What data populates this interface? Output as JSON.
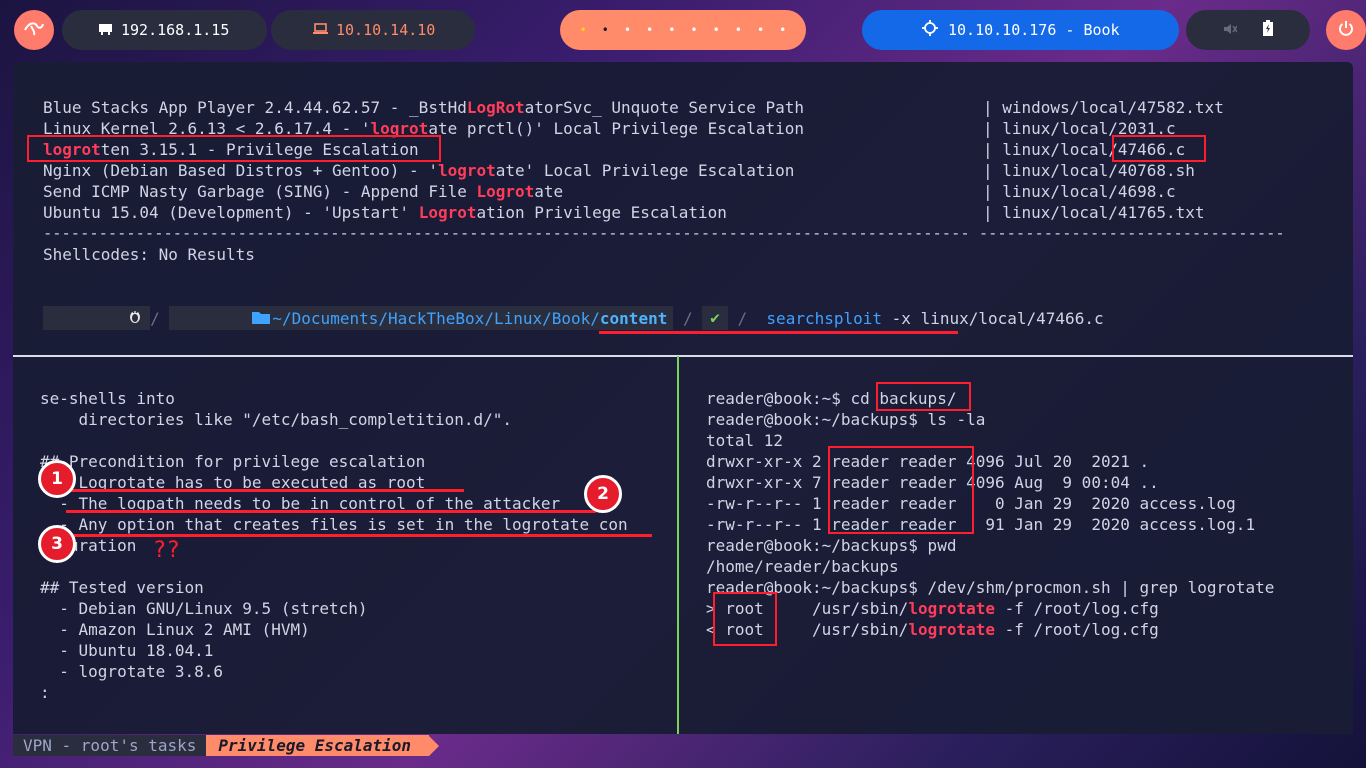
{
  "topbar": {
    "local_ip": "192.168.1.15",
    "vpn_ip": "10.10.14.10",
    "target": "10.10.10.176 - Book",
    "workspace_dots": [
      "•",
      "•",
      "•",
      "•",
      "•",
      "•",
      "•",
      "•",
      "•",
      "•"
    ]
  },
  "search_results": [
    {
      "title_pre": "Blue Stacks App Player 2.4.44.62.57 - _BstHd",
      "title_hl": "LogRot",
      "title_post": "atorSvc_ Unquote Service Path",
      "path": "windows/local/47582.txt"
    },
    {
      "title_pre": "Linux Kernel 2.6.13 < 2.6.17.4 - '",
      "title_hl": "logrot",
      "title_post": "ate prctl()' Local Privilege Escalation",
      "path": "linux/local/2031.c"
    },
    {
      "title_pre": "",
      "title_hl": "logrot",
      "title_post": "ten 3.15.1 - Privilege Escalation",
      "path": "linux/local/47466.c"
    },
    {
      "title_pre": "Nginx (Debian Based Distros + Gentoo) - '",
      "title_hl": "logrot",
      "title_post": "ate' Local Privilege Escalation",
      "path": "linux/local/40768.sh"
    },
    {
      "title_pre": "Send ICMP Nasty Garbage (SING) - Append File ",
      "title_hl": "Logrot",
      "title_post": "ate",
      "path": "linux/local/4698.c"
    },
    {
      "title_pre": "Ubuntu 15.04 (Development) - 'Upstart' ",
      "title_hl": "Logrot",
      "title_post": "ation Privilege Escalation",
      "path": "linux/local/41765.txt"
    }
  ],
  "separator": "---------------------------------------------------------------------------------------------------- ---------------------------------",
  "shellcodes": "Shellcodes: No Results",
  "prompt": {
    "path_prefix": "~/Documents/HackTheBox/Linux/Book/",
    "path_dir": "content",
    "check": "✔",
    "cmd": "searchsploit",
    "flag": "-x",
    "arg": "linux/local/47466.c"
  },
  "left_pane": [
    "se-shells into",
    "    directories like \"/etc/bash_completition.d/\".",
    "",
    "## Precondition for privilege escalation",
    "  - Logrotate has to be executed as root",
    "  - The logpath needs to be in control of the attacker",
    "  - Any option that creates files is set in the logrotate con",
    "figuration",
    "",
    "## Tested version",
    "  - Debian GNU/Linux 9.5 (stretch)",
    "  - Amazon Linux 2 AMI (HVM)",
    "  - Ubuntu 18.04.1",
    "  - logrotate 3.8.6",
    ":"
  ],
  "annotation_qmarks": "??",
  "badges": [
    "1",
    "2",
    "3"
  ],
  "right_pane": [
    "reader@book:~$ cd backups/",
    "reader@book:~/backups$ ls -la",
    "total 12",
    "drwxr-xr-x 2 reader reader 4096 Jul 20  2021 .",
    "drwxr-xr-x 7 reader reader 4096 Aug  9 00:04 ..",
    "-rw-r--r-- 1 reader reader    0 Jan 29  2020 access.log",
    "-rw-r--r-- 1 reader reader   91 Jan 29  2020 access.log.1",
    "reader@book:~/backups$ pwd",
    "/home/reader/backups",
    "reader@book:~/backups$ /dev/shm/procmon.sh | grep logrotate"
  ],
  "procmon": [
    {
      "dir": ">",
      "user": "root",
      "cmd_pre": "/usr/sbin/",
      "cmd_hl": "logrotate",
      "cmd_post": " -f /root/log.cfg"
    },
    {
      "dir": "<",
      "user": "root",
      "cmd_pre": "/usr/sbin/",
      "cmd_hl": "logrotate",
      "cmd_post": " -f /root/log.cfg"
    }
  ],
  "statusbar": {
    "session": "VPN - root's tasks",
    "window": "Privilege Escalation"
  },
  "colors": {
    "accent": "#ff6a5c",
    "blue": "#1469e8",
    "highlight": "#ff1e2e"
  }
}
